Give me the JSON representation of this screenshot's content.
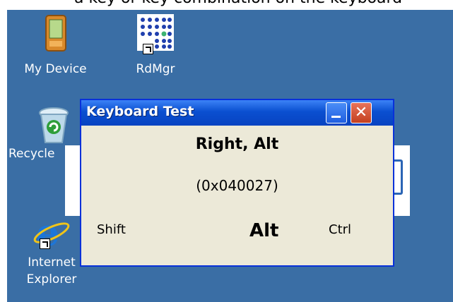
{
  "top_strip_text": "a key or key combination on the keyboard",
  "desktop": {
    "icons": [
      {
        "label": "My Device"
      },
      {
        "label": "RdMgr"
      },
      {
        "label": "Recycle"
      },
      {
        "label": "Internet Explorer"
      }
    ]
  },
  "window": {
    "title": "Keyboard Test",
    "minimize_icon": "minimize-icon",
    "close_glyph": "✕",
    "key_name": "Right, Alt",
    "key_code": "(0x040027)",
    "modifiers": {
      "shift": "Shift",
      "alt": "Alt",
      "ctrl": "Ctrl"
    }
  },
  "colors": {
    "desktop": "#3a6ea5",
    "titlebar": "#0a4fd0",
    "window_bg": "#ece9d8",
    "close_button": "#c4401f"
  }
}
